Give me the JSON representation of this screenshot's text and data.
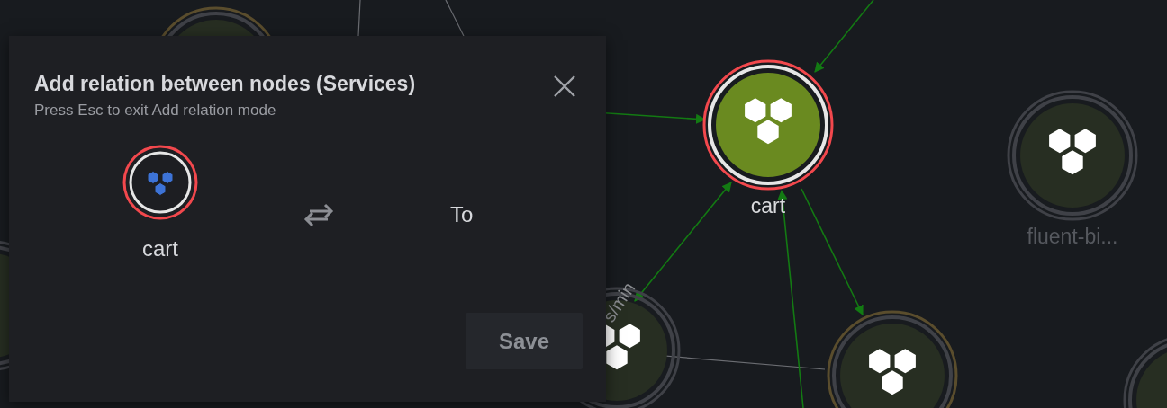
{
  "graph": {
    "nodes": [
      {
        "label": "cart",
        "selected": true
      },
      {
        "label": "fluent-bi...",
        "selected": false
      },
      {
        "selected": false
      },
      {
        "selected": false
      },
      {
        "selected": false
      },
      {
        "selected": false
      },
      {
        "selected": false
      }
    ],
    "edge_label": "s/min"
  },
  "dialog": {
    "title": "Add relation between nodes (Services)",
    "subtitle": "Press Esc to exit Add relation mode",
    "from": {
      "label": "cart"
    },
    "to_label": "To",
    "save": {
      "label": "Save",
      "disabled": true
    }
  }
}
